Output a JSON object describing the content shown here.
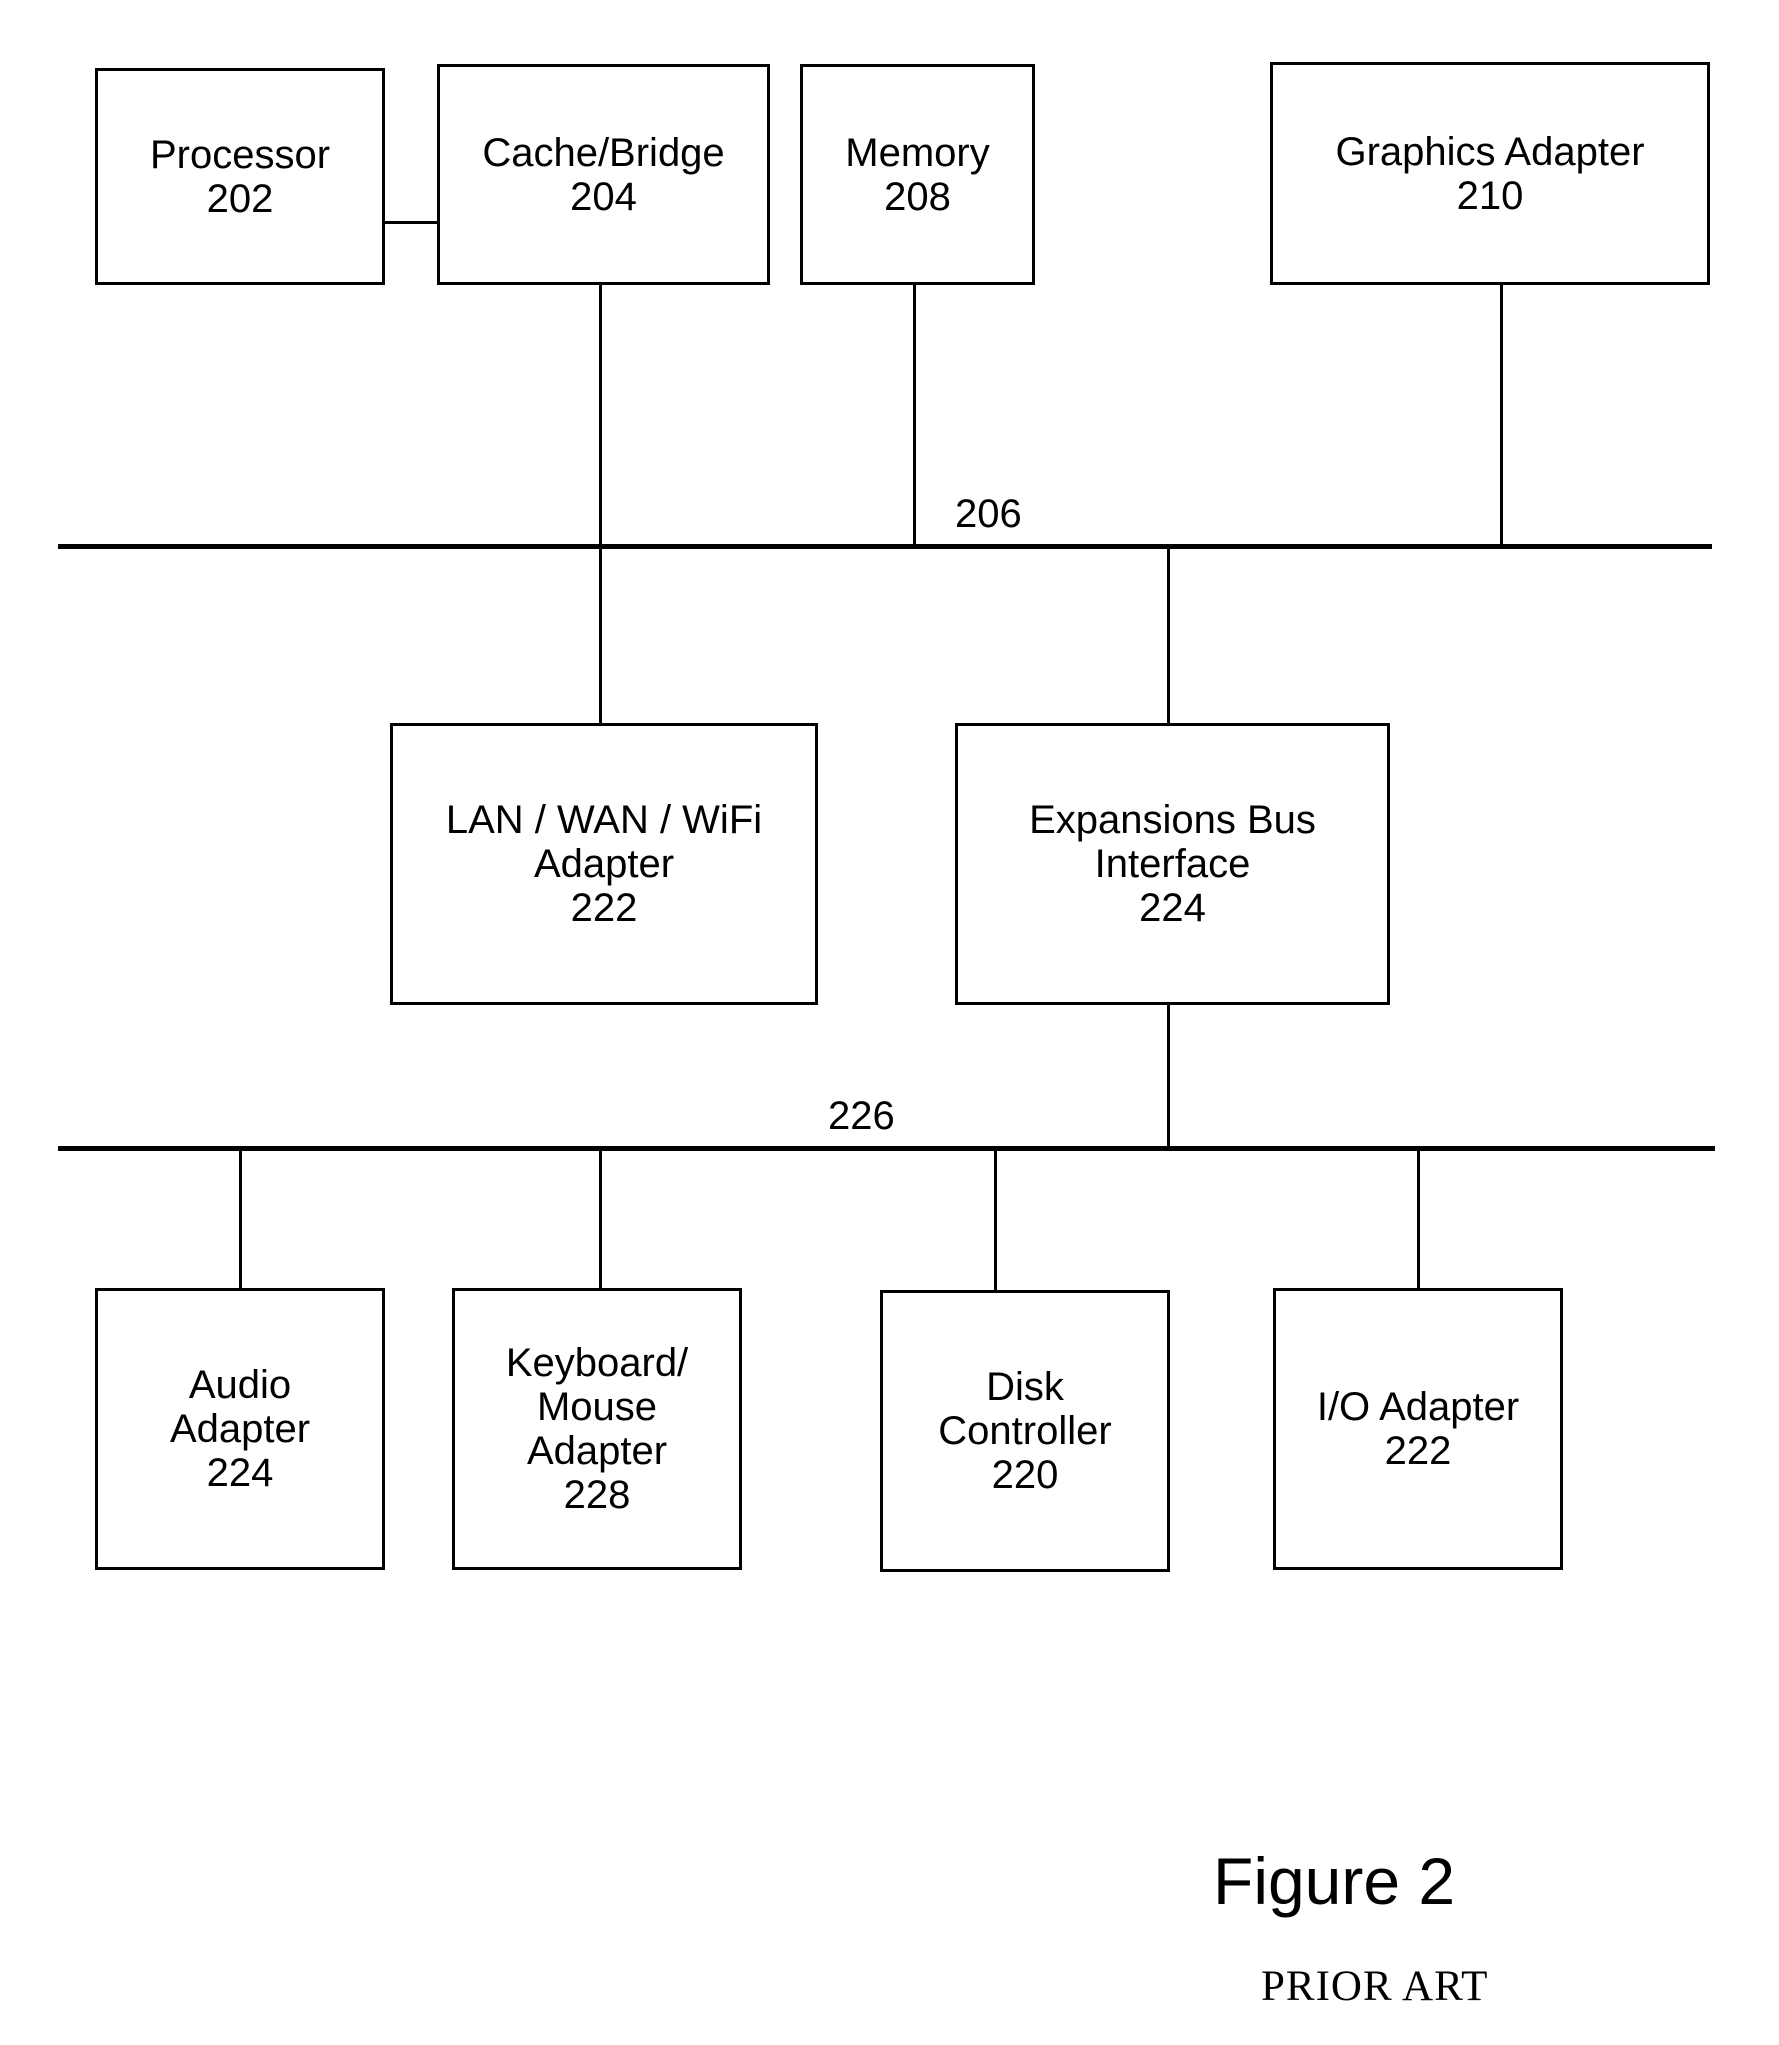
{
  "figure": {
    "caption": "Figure 2",
    "subcaption": "PRIOR ART"
  },
  "buses": [
    {
      "id": "bus-206",
      "label": "206"
    },
    {
      "id": "bus-226",
      "label": "226"
    }
  ],
  "blocks": {
    "processor": {
      "line1": "Processor",
      "line2": "202"
    },
    "cache_bridge": {
      "line1": "Cache/Bridge",
      "line2": "204"
    },
    "memory": {
      "line1": "Memory",
      "line2": "208"
    },
    "graphics": {
      "line1": "Graphics Adapter",
      "line2": "210"
    },
    "lan_wan_wifi": {
      "line1": "LAN / WAN / WiFi",
      "line2": "Adapter",
      "line3": "222"
    },
    "expansion_bus": {
      "line1": "Expansions Bus",
      "line2": "Interface",
      "line3": "224"
    },
    "audio": {
      "line1": "Audio",
      "line2": "Adapter",
      "line3": "224"
    },
    "keyboard_mouse": {
      "line1": "Keyboard/",
      "line2": "Mouse",
      "line3": "Adapter",
      "line4": "228"
    },
    "disk": {
      "line1": "Disk",
      "line2": "Controller",
      "line3": "220"
    },
    "io_adapter": {
      "line1": "I/O Adapter",
      "line2": "222"
    }
  },
  "colors": {
    "stroke": "#000000",
    "background": "#ffffff"
  },
  "chart_data": {
    "type": "diagram",
    "title": "Figure 2",
    "subtitle": "PRIOR ART",
    "nodes": [
      {
        "id": "202",
        "label": "Processor",
        "ref": "202",
        "row": "top"
      },
      {
        "id": "204",
        "label": "Cache/Bridge",
        "ref": "204",
        "row": "top"
      },
      {
        "id": "208",
        "label": "Memory",
        "ref": "208",
        "row": "top"
      },
      {
        "id": "210",
        "label": "Graphics Adapter",
        "ref": "210",
        "row": "top"
      },
      {
        "id": "222a",
        "label": "LAN / WAN / WiFi Adapter",
        "ref": "222",
        "row": "middle"
      },
      {
        "id": "224a",
        "label": "Expansions Bus Interface",
        "ref": "224",
        "row": "middle"
      },
      {
        "id": "224b",
        "label": "Audio Adapter",
        "ref": "224",
        "row": "bottom"
      },
      {
        "id": "228",
        "label": "Keyboard/Mouse Adapter",
        "ref": "228",
        "row": "bottom"
      },
      {
        "id": "220",
        "label": "Disk Controller",
        "ref": "220",
        "row": "bottom"
      },
      {
        "id": "222b",
        "label": "I/O Adapter",
        "ref": "222",
        "row": "bottom"
      }
    ],
    "buses": [
      {
        "ref": "206",
        "connects": [
          "204",
          "208",
          "210",
          "222a",
          "224a"
        ]
      },
      {
        "ref": "226",
        "connects": [
          "224a",
          "224b",
          "228",
          "220",
          "222b"
        ]
      }
    ],
    "edges": [
      {
        "from": "202",
        "to": "204",
        "type": "direct"
      },
      {
        "from": "204",
        "to": "206",
        "type": "bus-drop"
      },
      {
        "from": "208",
        "to": "206",
        "type": "bus-drop"
      },
      {
        "from": "210",
        "to": "206",
        "type": "bus-drop"
      },
      {
        "from": "206",
        "to": "222a",
        "type": "bus-drop"
      },
      {
        "from": "206",
        "to": "224a",
        "type": "bus-drop"
      },
      {
        "from": "224a",
        "to": "226",
        "type": "bus-drop"
      },
      {
        "from": "226",
        "to": "224b",
        "type": "bus-drop"
      },
      {
        "from": "226",
        "to": "228",
        "type": "bus-drop"
      },
      {
        "from": "226",
        "to": "220",
        "type": "bus-drop"
      },
      {
        "from": "226",
        "to": "222b",
        "type": "bus-drop"
      }
    ]
  }
}
